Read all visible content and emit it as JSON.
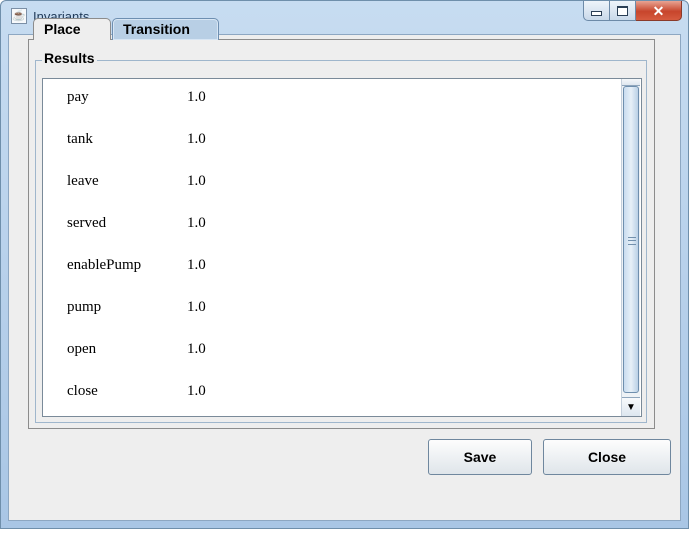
{
  "window": {
    "title": "Invariants",
    "app_icon": "java-cup-icon",
    "controls": [
      "minimize-icon",
      "maximize-icon",
      "close-icon"
    ]
  },
  "tabs": [
    {
      "label": "Place",
      "selected": false
    },
    {
      "label": "Transition",
      "selected": true
    }
  ],
  "results": {
    "title": "Results",
    "rows": [
      {
        "name": "pay",
        "value": "1.0"
      },
      {
        "name": "tank",
        "value": "1.0"
      },
      {
        "name": "leave",
        "value": "1.0"
      },
      {
        "name": "served",
        "value": "1.0"
      },
      {
        "name": "enablePump",
        "value": "1.0"
      },
      {
        "name": "pump",
        "value": "1.0"
      },
      {
        "name": "open",
        "value": "1.0"
      },
      {
        "name": "close",
        "value": "1.0"
      }
    ]
  },
  "buttons": {
    "save": "Save",
    "close": "Close"
  },
  "colors": {
    "selected_tab": "#b8cfe5",
    "client_background": "#eeeeee",
    "close_button": "#c7452c"
  }
}
